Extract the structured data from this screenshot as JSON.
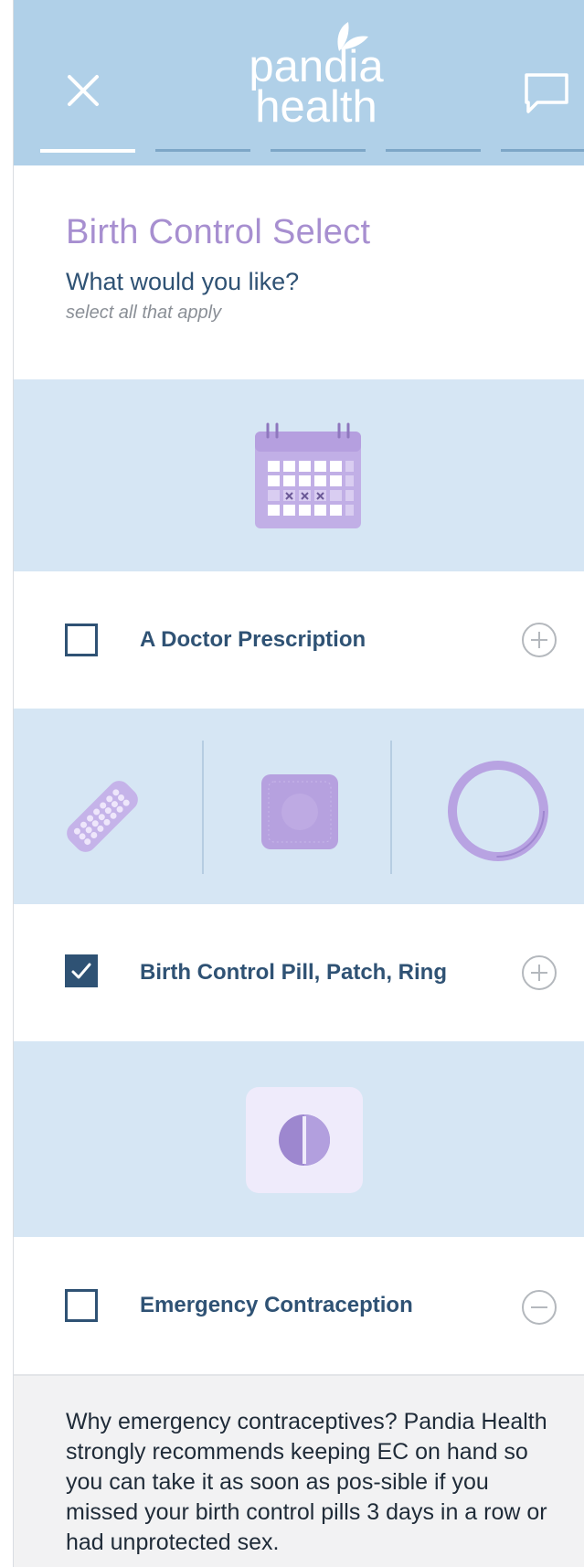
{
  "header": {
    "brand_line1": "pandia",
    "brand_line2": "health",
    "progress": {
      "total_steps": 5,
      "current_step": 1
    }
  },
  "intro": {
    "title": "Birth Control Select",
    "question": "What would you like?",
    "hint": "select all that apply"
  },
  "options": [
    {
      "label": "A Doctor Prescription",
      "checked": false,
      "expanded": false,
      "illustration": "calendar-icon"
    },
    {
      "label": "Birth Control Pill, Patch, Ring",
      "checked": true,
      "expanded": false,
      "illustration": [
        "pill-pack-icon",
        "patch-icon",
        "ring-icon"
      ]
    },
    {
      "label": "Emergency Contraception",
      "checked": false,
      "expanded": true,
      "illustration": "tablet-icon"
    }
  ],
  "info": {
    "text": "Why emergency contraceptives? Pandia Health strongly recommends keeping EC on hand so you can take it as soon as pos-sible if you missed your birth control pills 3 days in a row or had unprotected sex."
  },
  "colors": {
    "header_bg": "#b0d0e8",
    "band_bg": "#d6e6f4",
    "navy": "#2f5274",
    "lavender": "#a78fd0"
  }
}
